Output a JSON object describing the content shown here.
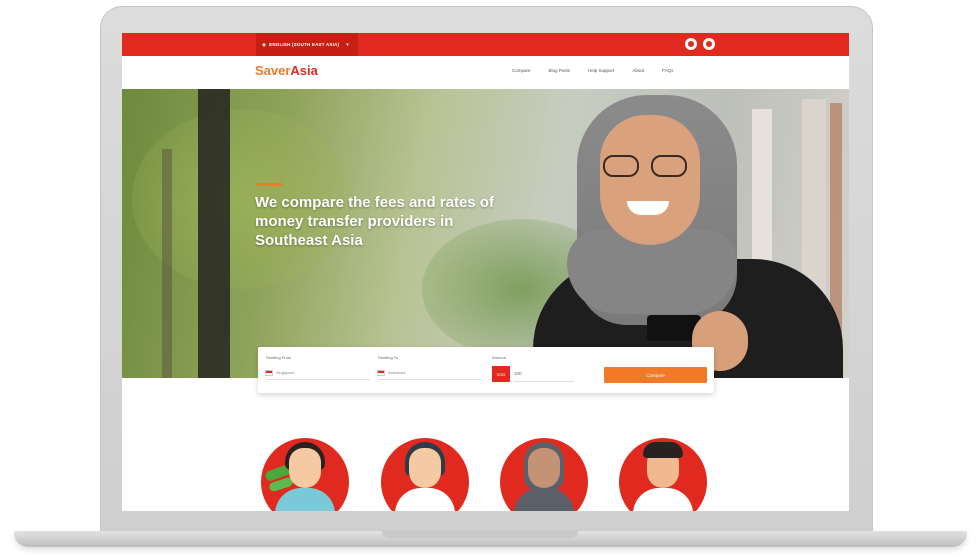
{
  "topbar": {
    "language_selector": "ENGLISH (SOUTH EAST ASIA)",
    "social": [
      "facebook-icon",
      "instagram-icon"
    ]
  },
  "brand": {
    "logo_part1": "Saver",
    "logo_part2": "Asia",
    "colors": {
      "primary": "#e02a1f",
      "accent": "#f07a26"
    }
  },
  "nav": {
    "items": [
      "Compare",
      "Blog Posts",
      "Help Support",
      "About",
      "FAQs"
    ]
  },
  "hero": {
    "headline": "We compare the fees and rates of money transfer providers in Southeast Asia"
  },
  "compare_form": {
    "sending_from_label": "Sending From",
    "sending_from_value": "Singapore",
    "sending_to_label": "Sending To",
    "sending_to_value": "Indonesia",
    "amount_label": "Amount",
    "currency": "SGD",
    "amount_value": "100",
    "submit_label": "Compare"
  },
  "avatars": [
    "user-avatar-1",
    "user-avatar-2",
    "user-avatar-3",
    "user-avatar-4"
  ]
}
